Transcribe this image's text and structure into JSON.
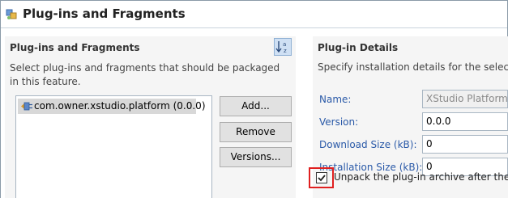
{
  "header": {
    "title": "Plug-ins and Fragments"
  },
  "left": {
    "title": "Plug-ins and Fragments",
    "description": "Select plug-ins and fragments that should be packaged in this feature.",
    "items": [
      {
        "label": "com.owner.xstudio.platform (0.0.0)"
      }
    ],
    "buttons": {
      "add": "Add...",
      "remove": "Remove",
      "versions": "Versions..."
    }
  },
  "details": {
    "title": "Plug-in Details",
    "description": "Specify installation details for the selecte",
    "name_label": "Name:",
    "name_value": "XStudio Platform",
    "version_label": "Version:",
    "version_value": "0.0.0",
    "download_label": "Download Size (kB):",
    "download_value": "0",
    "install_label": "Installation Size (kB):",
    "install_value": "0",
    "unpack_label": "Unpack the plug-in archive after the i",
    "unpack_checked": true
  },
  "colors": {
    "link_label": "#2b5aa8",
    "highlight": "#e02020",
    "section_bg": "#f5f5f5"
  }
}
